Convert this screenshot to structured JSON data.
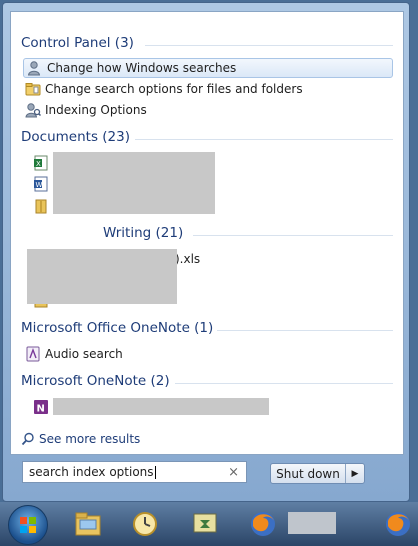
{
  "search": {
    "query": "search index options",
    "see_more": "See more results",
    "shutdown": "Shut down"
  },
  "control_panel": {
    "header": "Control Panel (3)",
    "items": [
      {
        "label": "Change how Windows searches"
      },
      {
        "label": "Change search options for files and folders"
      },
      {
        "label": "Indexing Options"
      }
    ]
  },
  "documents": {
    "header": "Documents (23)"
  },
  "writing": {
    "header": "Writing (21)",
    "partial_item": ").xls"
  },
  "office_onenote": {
    "header": "Microsoft Office OneNote (1)",
    "items": [
      {
        "label": "Audio search"
      }
    ]
  },
  "onenote": {
    "header": "Microsoft OneNote (2)"
  },
  "icons": {
    "search": "magnifier-icon",
    "windows": "windows-orb-icon",
    "clear": "close-icon"
  }
}
